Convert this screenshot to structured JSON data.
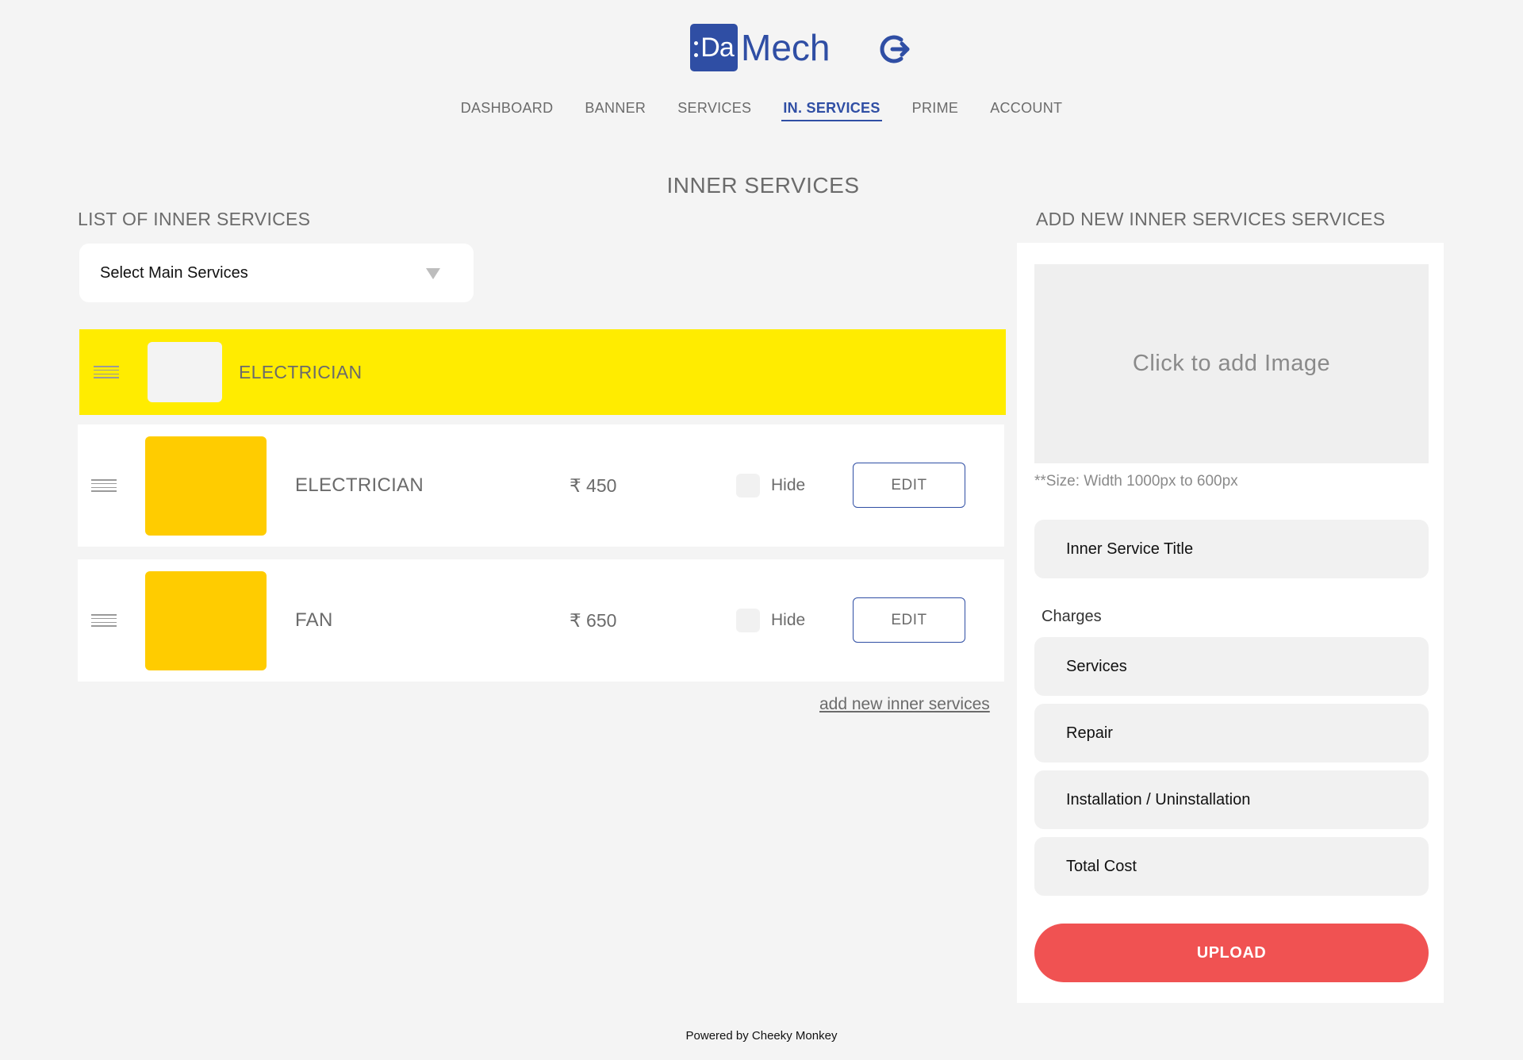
{
  "brand": {
    "logo_mark": "Da",
    "logo_text": "Mech",
    "accent_color": "#2f4ea4",
    "icon": "logout-icon"
  },
  "nav": [
    {
      "label": "DASHBOARD",
      "active": false
    },
    {
      "label": "BANNER",
      "active": false
    },
    {
      "label": "SERVICES",
      "active": false
    },
    {
      "label": "IN. SERVICES",
      "active": true
    },
    {
      "label": "PRIME",
      "active": false
    },
    {
      "label": "ACCOUNT",
      "active": false
    }
  ],
  "page_title": "INNER SERVICES",
  "list": {
    "title": "LIST OF INNER SERVICES",
    "select_label": "Select Main Services",
    "category": {
      "label": "ELECTRICIAN",
      "highlight_color": "#ffec00"
    },
    "items": [
      {
        "name": "ELECTRICIAN",
        "price": "₹ 450",
        "hide_label": "Hide",
        "edit_label": "EDIT",
        "hidden": false
      },
      {
        "name": "FAN",
        "price": "₹ 650",
        "hide_label": "Hide",
        "edit_label": "EDIT",
        "hidden": false
      }
    ],
    "add_link": "add new inner services"
  },
  "form": {
    "title": "ADD NEW INNER SERVICES SERVICES",
    "image_placeholder": "Click to add Image",
    "size_note": "**Size: Width 1000px to 600px",
    "title_placeholder": "Inner Service Title",
    "charges_label": "Charges",
    "services_placeholder": "Services",
    "repair_placeholder": "Repair",
    "install_placeholder": "Installation / Uninstallation",
    "total_placeholder": "Total Cost",
    "upload_label": "UPLOAD",
    "upload_color": "#f05252"
  },
  "footer": "Powered by Cheeky Monkey"
}
